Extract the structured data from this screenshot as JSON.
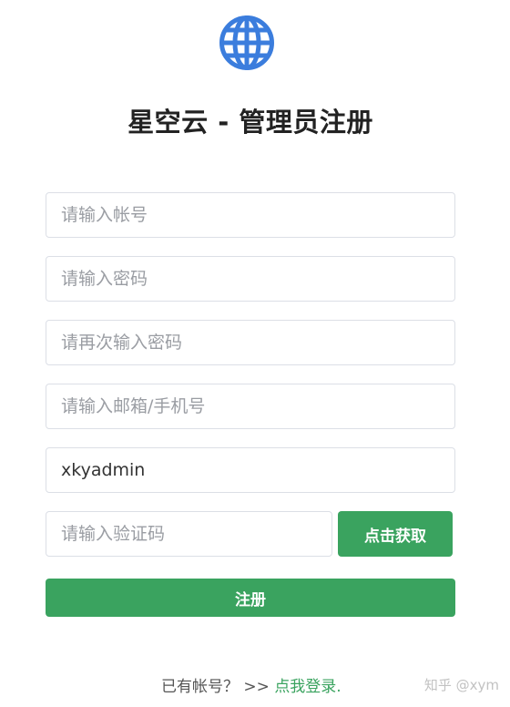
{
  "app": {
    "title": "星空云 - 管理员注册",
    "logo_icon": "globe-icon",
    "accent_color": "#3aa35f",
    "logo_color": "#3b7ddd"
  },
  "form": {
    "account": {
      "placeholder": "请输入帐号",
      "value": ""
    },
    "password": {
      "placeholder": "请输入密码",
      "value": ""
    },
    "password_confirm": {
      "placeholder": "请再次输入密码",
      "value": ""
    },
    "contact": {
      "placeholder": "请输入邮箱/手机号",
      "value": ""
    },
    "username": {
      "placeholder": "",
      "value": "xkyadmin"
    },
    "captcha": {
      "placeholder": "请输入验证码",
      "value": ""
    },
    "get_code_label": "点击获取",
    "register_label": "注册"
  },
  "footer": {
    "prompt": "已有帐号？",
    "arrows": ">>",
    "login_link": "点我登录."
  },
  "watermark": "知乎 @xym"
}
